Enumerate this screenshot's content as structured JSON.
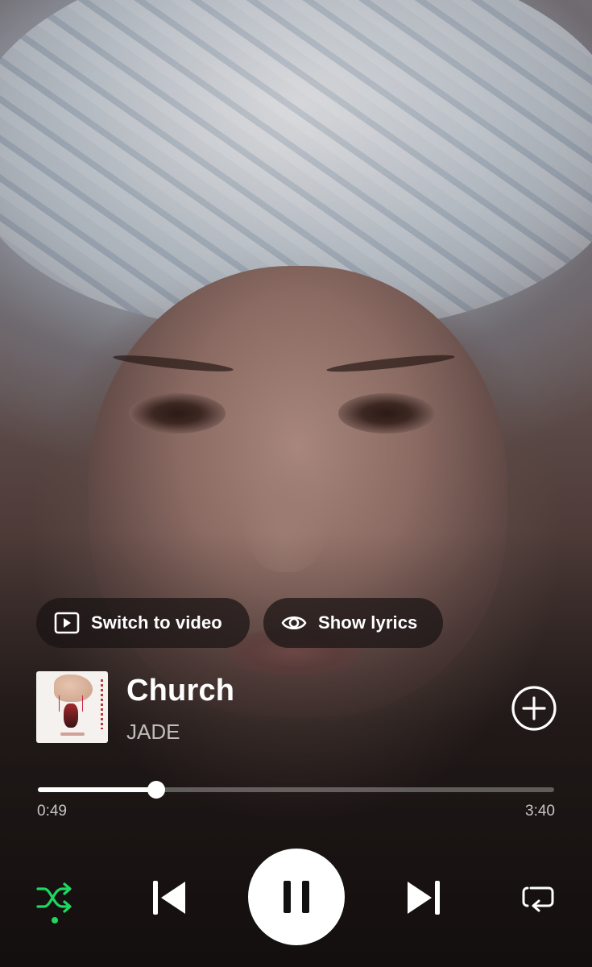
{
  "actions": {
    "switch_to_video": "Switch to video",
    "show_lyrics": "Show lyrics"
  },
  "track": {
    "title": "Church",
    "artist": "JADE"
  },
  "playback": {
    "elapsed": "0:49",
    "total": "3:40",
    "progress_fraction": 0.229,
    "shuffle_on": true,
    "is_playing": true
  },
  "colors": {
    "accent_shuffle": "#1ed760",
    "text_primary": "#ffffff",
    "text_secondary": "rgba(255,255,255,0.7)"
  },
  "icons": {
    "switch_video": "play-square-icon",
    "show_lyrics": "eye-icon",
    "add": "plus-circle-icon",
    "shuffle": "shuffle-icon",
    "previous": "skip-previous-icon",
    "pause": "pause-icon",
    "next": "skip-next-icon",
    "repeat": "repeat-icon"
  }
}
